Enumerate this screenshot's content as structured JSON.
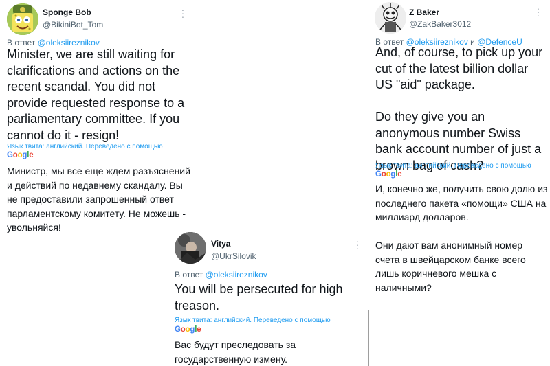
{
  "tweets": [
    {
      "author": "Sponge Bob",
      "handle": "@BikiniBot_Tom",
      "reply_prefix": "В ответ",
      "reply_to": "@oleksiireznikov",
      "reply_joiner": "",
      "reply_to_2": "",
      "text": "Minister, we are still waiting for clarifications and actions on the recent scandal. You did not provide requested response to a parliamentary committee. If you cannot do it - resign!",
      "translation_note": "Язык твита: английский. Переведено с помощью",
      "translation_engine": "Google",
      "translated_text": "Министр, мы все еще ждем разъяснений и действий по недавнему скандалу. Вы не предоставили запрошенный ответ парламентскому комитету. Не можешь - увольняйся!"
    },
    {
      "author": "Z Baker",
      "handle": "@ZakBaker3012",
      "reply_prefix": "В ответ",
      "reply_to": "@oleksiireznikov",
      "reply_joiner": "и",
      "reply_to_2": "@DefenceU",
      "text": "And, of course, to pick up your cut of the latest billion dollar US \"aid\" package.\n\nDo they give you an anonymous number Swiss bank account number of just a brown bag of cash?",
      "translation_note": "Язык твита: английский. Переведено с помощью",
      "translation_engine": "Google",
      "translated_text": "И, конечно же, получить свою долю из последнего пакета «помощи» США на миллиард долларов.\n\nОни дают вам анонимный номер счета в швейцарском банке всего лишь коричневого мешка с наличными?"
    },
    {
      "author": "Vitya",
      "handle": "@UkrSilovik",
      "reply_prefix": "В ответ",
      "reply_to": "@oleksiireznikov",
      "reply_joiner": "",
      "reply_to_2": "",
      "text": "You will be persecuted for high treason.",
      "translation_note": "Язык твита: английский. Переведено с помощью",
      "translation_engine": "Google",
      "translated_text": "Вас будут преследовать за государственную измену."
    }
  ],
  "colors": {
    "link": "#1d9bf0",
    "secondary_text": "#536471",
    "primary_text": "#0f1419"
  },
  "icons": [
    "more-vertical-icon"
  ]
}
